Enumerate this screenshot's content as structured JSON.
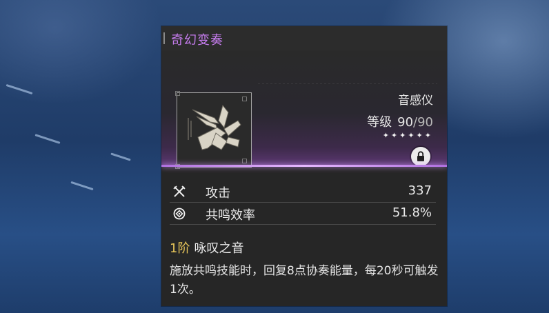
{
  "weapon": {
    "name": "奇幻变奏",
    "type": "音感仪",
    "level_label": "等级",
    "level_current": "90",
    "level_max": "/90",
    "stars": "✦✦✦✦✦✦",
    "locked": true
  },
  "stats": [
    {
      "name": "攻击",
      "value": "337",
      "icon": "crossed-swords-icon"
    },
    {
      "name": "共鸣效率",
      "value": "51.8%",
      "icon": "resonance-icon"
    }
  ],
  "passive": {
    "rank": "1阶",
    "name": "咏叹之音",
    "description": "施放共鸣技能时，回复8点协奏能量，每20秒可触发1次。"
  },
  "colors": {
    "title": "#c77df0",
    "rank": "#e8c65a",
    "glow": "#d49cff"
  }
}
